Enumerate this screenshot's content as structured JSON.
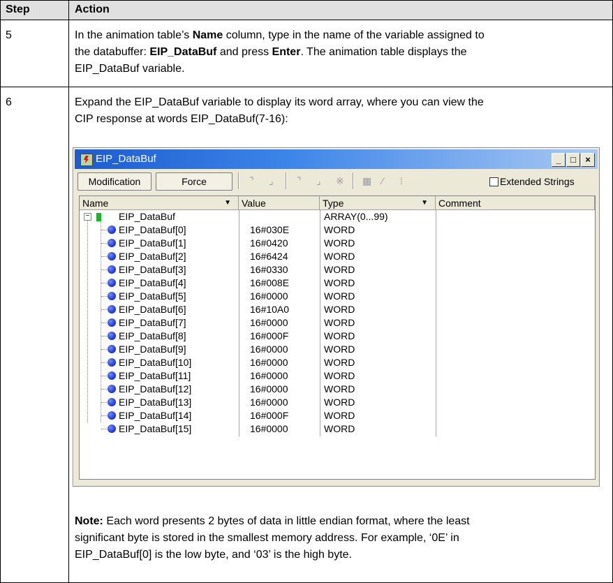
{
  "table": {
    "header": {
      "step": "Step",
      "action": "Action"
    },
    "rows": [
      {
        "step": "5",
        "lines": [
          {
            "t1": "In the animation table’s ",
            "b1": "Name",
            "t2": " column, type in the name of the variable assigned to"
          },
          {
            "t1": "the databuffer: ",
            "b1": "EIP_DataBuf",
            "t2": " and press ",
            "b2": "Enter",
            "t3": ". The animation table displays the"
          },
          {
            "t1": "EIP_DataBuf variable."
          }
        ]
      },
      {
        "step": "6",
        "lines": [
          "Expand the EIP_DataBuf variable to display its word array, where you can view the",
          "CIP response at words EIP_DataBuf(7-16):"
        ],
        "note_label": "Note:",
        "note_lines": [
          " Each word presents 2 bytes of data in little endian format, where the least",
          "significant byte is stored in the smallest memory address. For example, ‘0E’ in",
          "EIP_DataBuf[0] is the low byte, and ‘03’ is the high byte."
        ]
      }
    ]
  },
  "window": {
    "title": "EIP_DataBuf",
    "buttons": {
      "minimize": "_",
      "maximize": "□",
      "close": "×"
    },
    "toolbar": {
      "modification": "Modification",
      "force": "Force",
      "extended_strings": "Extended Strings",
      "extended_checked": false
    },
    "columns": {
      "name": "Name",
      "value": "Value",
      "type": "Type",
      "comment": "Comment"
    },
    "parent": {
      "name": "EIP_DataBuf",
      "value": "",
      "type": "ARRAY(0...99)",
      "comment": ""
    },
    "items": [
      {
        "name": "EIP_DataBuf[0]",
        "value": "16#030E",
        "type": "WORD"
      },
      {
        "name": "EIP_DataBuf[1]",
        "value": "16#0420",
        "type": "WORD"
      },
      {
        "name": "EIP_DataBuf[2]",
        "value": "16#6424",
        "type": "WORD"
      },
      {
        "name": "EIP_DataBuf[3]",
        "value": "16#0330",
        "type": "WORD"
      },
      {
        "name": "EIP_DataBuf[4]",
        "value": "16#008E",
        "type": "WORD"
      },
      {
        "name": "EIP_DataBuf[5]",
        "value": "16#0000",
        "type": "WORD"
      },
      {
        "name": "EIP_DataBuf[6]",
        "value": "16#10A0",
        "type": "WORD"
      },
      {
        "name": "EIP_DataBuf[7]",
        "value": "16#0000",
        "type": "WORD"
      },
      {
        "name": "EIP_DataBuf[8]",
        "value": "16#000F",
        "type": "WORD"
      },
      {
        "name": "EIP_DataBuf[9]",
        "value": "16#0000",
        "type": "WORD"
      },
      {
        "name": "EIP_DataBuf[10]",
        "value": "16#0000",
        "type": "WORD"
      },
      {
        "name": "EIP_DataBuf[11]",
        "value": "16#0000",
        "type": "WORD"
      },
      {
        "name": "EIP_DataBuf[12]",
        "value": "16#0000",
        "type": "WORD"
      },
      {
        "name": "EIP_DataBuf[13]",
        "value": "16#0000",
        "type": "WORD"
      },
      {
        "name": "EIP_DataBuf[14]",
        "value": "16#000F",
        "type": "WORD"
      },
      {
        "name": "EIP_DataBuf[15]",
        "value": "16#0000",
        "type": "WORD"
      }
    ]
  }
}
